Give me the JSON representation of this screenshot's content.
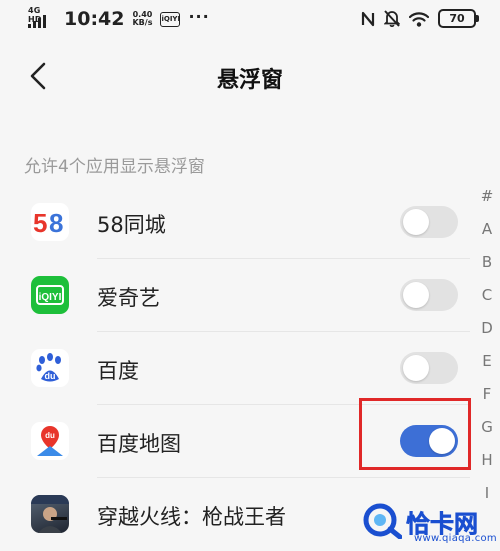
{
  "status_bar": {
    "network": "4G HD",
    "time": "10:42",
    "speed_value": "0.40",
    "speed_unit": "KB/s",
    "app_badge": "iQIYI",
    "overflow": "···",
    "battery": "70"
  },
  "nav": {
    "title": "悬浮窗"
  },
  "section": {
    "header": "允许4个应用显示悬浮窗"
  },
  "apps": [
    {
      "name": "58同城",
      "icon": "58-tongcheng-icon",
      "enabled": false
    },
    {
      "name": "爱奇艺",
      "icon": "iqiyi-icon",
      "enabled": false
    },
    {
      "name": "百度",
      "icon": "baidu-icon",
      "enabled": false
    },
    {
      "name": "百度地图",
      "icon": "baidu-map-icon",
      "enabled": true
    },
    {
      "name": "穿越火线：枪战王者",
      "icon": "crossfire-icon",
      "enabled": false
    }
  ],
  "alpha_index": [
    "#",
    "A",
    "B",
    "C",
    "D",
    "E",
    "F",
    "G",
    "H",
    "I"
  ],
  "watermark": {
    "text": "恰卡网",
    "url": "www.qiaqa.com"
  },
  "colors": {
    "toggle_on": "#3d6fd6",
    "toggle_off": "#e2e2e2",
    "highlight": "#e02828",
    "watermark": "#1a4fd0"
  }
}
